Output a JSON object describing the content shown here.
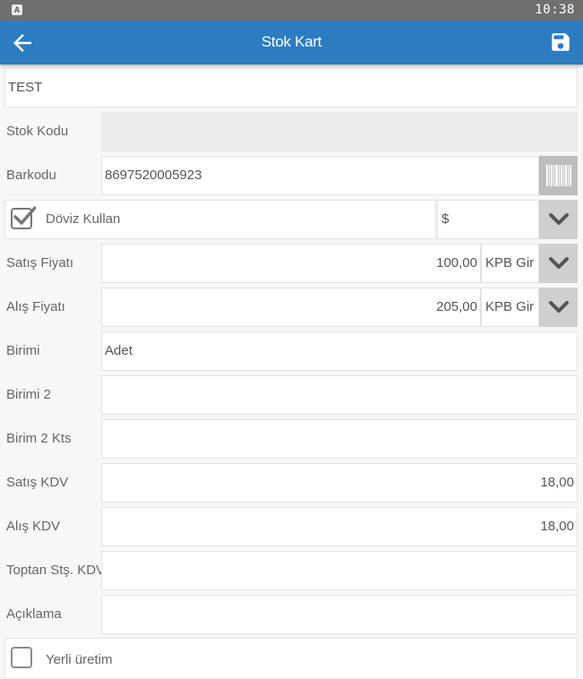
{
  "status_bar": {
    "app_badge": "A",
    "time": "10:38"
  },
  "app_bar": {
    "title": "Stok Kart"
  },
  "form": {
    "name": {
      "value": "TEST"
    },
    "stock_code": {
      "label": "Stok Kodu",
      "value": ""
    },
    "barcode": {
      "label": "Barkodu",
      "value": "8697520005923"
    },
    "currency": {
      "label": "Döviz Kullan",
      "checked": true,
      "value": "$"
    },
    "sale_price": {
      "label": "Satış Fiyatı",
      "value": "100,00",
      "unit": "KPB Gir"
    },
    "purchase_price": {
      "label": "Alış Fiyatı",
      "value": "205,00",
      "unit": "KPB Gir"
    },
    "unit1": {
      "label": "Birimi",
      "value": "Adet"
    },
    "unit2": {
      "label": "Birimi 2",
      "value": ""
    },
    "unit2_ratio": {
      "label": "Birim 2 Kts",
      "value": ""
    },
    "sale_vat": {
      "label": "Satış KDV",
      "value": "18,00"
    },
    "purchase_vat": {
      "label": "Alış KDV",
      "value": "18,00"
    },
    "wholesale_vat": {
      "label": "Toptan Stş. KDV",
      "value": ""
    },
    "description": {
      "label": "Açıklama",
      "value": ""
    },
    "local_production": {
      "label": "Yerli üretim",
      "checked": false
    }
  },
  "colors": {
    "app_bar": "#2c7cc2",
    "status_bar": "#6f6f6f",
    "dropdown_button": "#cfcfcf"
  }
}
